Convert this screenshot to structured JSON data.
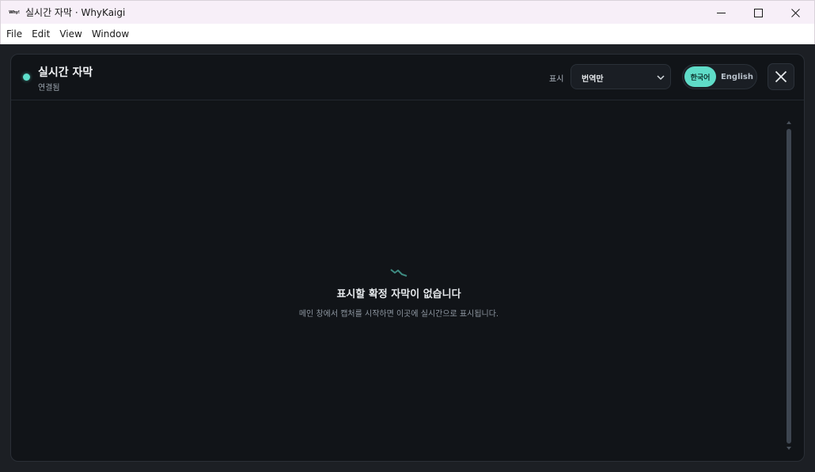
{
  "window": {
    "logo_text": "Why!",
    "title": "실시간 자막 · WhyKaigi"
  },
  "menu": {
    "items": [
      "File",
      "Edit",
      "View",
      "Window"
    ]
  },
  "header": {
    "title": "실시간 자막",
    "status": "연결됨",
    "status_color": "#5ee0cc"
  },
  "display": {
    "label": "표시",
    "selected": "번역만"
  },
  "language_toggle": {
    "korean": "한국어",
    "english": "English",
    "active": "한국어",
    "accent": "#5fdcc8"
  },
  "empty_state": {
    "icon": "waveform-icon",
    "title": "표시할 확정 자막이 없습니다",
    "description": "메인 창에서 캡처를 시작하면 이곳에 실시간으로 표시됩니다."
  },
  "icons": {
    "close": "close-icon",
    "chevron": "chevron-down-icon",
    "minimize": "minimize-icon",
    "maximize": "maximize-icon",
    "window_close": "window-close-icon"
  }
}
